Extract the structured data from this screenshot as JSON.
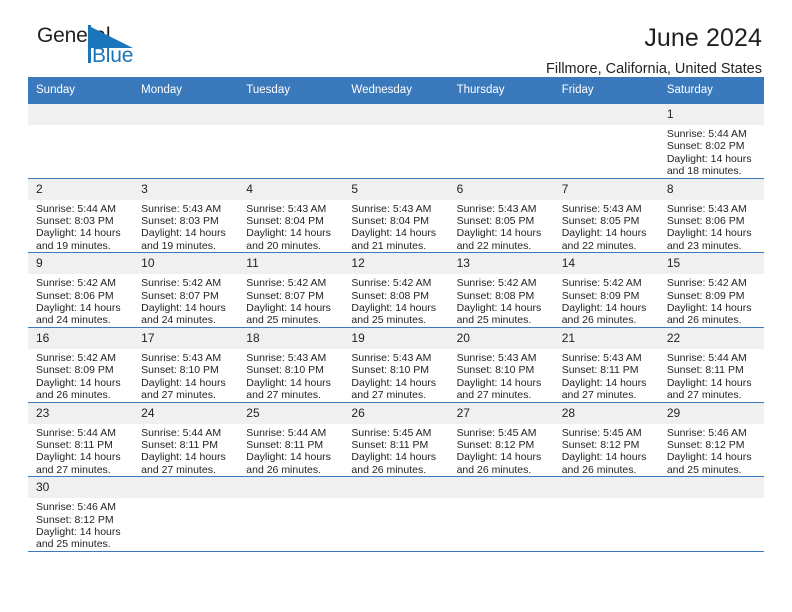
{
  "brand": {
    "word_one": "General",
    "word_two": "Blue",
    "accent_color": "#1b75bb",
    "flag_icon": "brand-flag-icon"
  },
  "header": {
    "title": "June 2024",
    "subtitle": "Fillmore, California, United States"
  },
  "calendar": {
    "header_color": "#3b79bd",
    "weekday_headers": [
      "Sunday",
      "Monday",
      "Tuesday",
      "Wednesday",
      "Thursday",
      "Friday",
      "Saturday"
    ],
    "weeks": [
      [
        {
          "day": "",
          "empty": true
        },
        {
          "day": "",
          "empty": true
        },
        {
          "day": "",
          "empty": true
        },
        {
          "day": "",
          "empty": true
        },
        {
          "day": "",
          "empty": true
        },
        {
          "day": "",
          "empty": true
        },
        {
          "day": "1",
          "sunrise": "Sunrise: 5:44 AM",
          "sunset": "Sunset: 8:02 PM",
          "daylight_line1": "Daylight: 14 hours",
          "daylight_line2": "and 18 minutes."
        }
      ],
      [
        {
          "day": "2",
          "sunrise": "Sunrise: 5:44 AM",
          "sunset": "Sunset: 8:03 PM",
          "daylight_line1": "Daylight: 14 hours",
          "daylight_line2": "and 19 minutes."
        },
        {
          "day": "3",
          "sunrise": "Sunrise: 5:43 AM",
          "sunset": "Sunset: 8:03 PM",
          "daylight_line1": "Daylight: 14 hours",
          "daylight_line2": "and 19 minutes."
        },
        {
          "day": "4",
          "sunrise": "Sunrise: 5:43 AM",
          "sunset": "Sunset: 8:04 PM",
          "daylight_line1": "Daylight: 14 hours",
          "daylight_line2": "and 20 minutes."
        },
        {
          "day": "5",
          "sunrise": "Sunrise: 5:43 AM",
          "sunset": "Sunset: 8:04 PM",
          "daylight_line1": "Daylight: 14 hours",
          "daylight_line2": "and 21 minutes."
        },
        {
          "day": "6",
          "sunrise": "Sunrise: 5:43 AM",
          "sunset": "Sunset: 8:05 PM",
          "daylight_line1": "Daylight: 14 hours",
          "daylight_line2": "and 22 minutes."
        },
        {
          "day": "7",
          "sunrise": "Sunrise: 5:43 AM",
          "sunset": "Sunset: 8:05 PM",
          "daylight_line1": "Daylight: 14 hours",
          "daylight_line2": "and 22 minutes."
        },
        {
          "day": "8",
          "sunrise": "Sunrise: 5:43 AM",
          "sunset": "Sunset: 8:06 PM",
          "daylight_line1": "Daylight: 14 hours",
          "daylight_line2": "and 23 minutes."
        }
      ],
      [
        {
          "day": "9",
          "sunrise": "Sunrise: 5:42 AM",
          "sunset": "Sunset: 8:06 PM",
          "daylight_line1": "Daylight: 14 hours",
          "daylight_line2": "and 24 minutes."
        },
        {
          "day": "10",
          "sunrise": "Sunrise: 5:42 AM",
          "sunset": "Sunset: 8:07 PM",
          "daylight_line1": "Daylight: 14 hours",
          "daylight_line2": "and 24 minutes."
        },
        {
          "day": "11",
          "sunrise": "Sunrise: 5:42 AM",
          "sunset": "Sunset: 8:07 PM",
          "daylight_line1": "Daylight: 14 hours",
          "daylight_line2": "and 25 minutes."
        },
        {
          "day": "12",
          "sunrise": "Sunrise: 5:42 AM",
          "sunset": "Sunset: 8:08 PM",
          "daylight_line1": "Daylight: 14 hours",
          "daylight_line2": "and 25 minutes."
        },
        {
          "day": "13",
          "sunrise": "Sunrise: 5:42 AM",
          "sunset": "Sunset: 8:08 PM",
          "daylight_line1": "Daylight: 14 hours",
          "daylight_line2": "and 25 minutes."
        },
        {
          "day": "14",
          "sunrise": "Sunrise: 5:42 AM",
          "sunset": "Sunset: 8:09 PM",
          "daylight_line1": "Daylight: 14 hours",
          "daylight_line2": "and 26 minutes."
        },
        {
          "day": "15",
          "sunrise": "Sunrise: 5:42 AM",
          "sunset": "Sunset: 8:09 PM",
          "daylight_line1": "Daylight: 14 hours",
          "daylight_line2": "and 26 minutes."
        }
      ],
      [
        {
          "day": "16",
          "sunrise": "Sunrise: 5:42 AM",
          "sunset": "Sunset: 8:09 PM",
          "daylight_line1": "Daylight: 14 hours",
          "daylight_line2": "and 26 minutes."
        },
        {
          "day": "17",
          "sunrise": "Sunrise: 5:43 AM",
          "sunset": "Sunset: 8:10 PM",
          "daylight_line1": "Daylight: 14 hours",
          "daylight_line2": "and 27 minutes."
        },
        {
          "day": "18",
          "sunrise": "Sunrise: 5:43 AM",
          "sunset": "Sunset: 8:10 PM",
          "daylight_line1": "Daylight: 14 hours",
          "daylight_line2": "and 27 minutes."
        },
        {
          "day": "19",
          "sunrise": "Sunrise: 5:43 AM",
          "sunset": "Sunset: 8:10 PM",
          "daylight_line1": "Daylight: 14 hours",
          "daylight_line2": "and 27 minutes."
        },
        {
          "day": "20",
          "sunrise": "Sunrise: 5:43 AM",
          "sunset": "Sunset: 8:10 PM",
          "daylight_line1": "Daylight: 14 hours",
          "daylight_line2": "and 27 minutes."
        },
        {
          "day": "21",
          "sunrise": "Sunrise: 5:43 AM",
          "sunset": "Sunset: 8:11 PM",
          "daylight_line1": "Daylight: 14 hours",
          "daylight_line2": "and 27 minutes."
        },
        {
          "day": "22",
          "sunrise": "Sunrise: 5:44 AM",
          "sunset": "Sunset: 8:11 PM",
          "daylight_line1": "Daylight: 14 hours",
          "daylight_line2": "and 27 minutes."
        }
      ],
      [
        {
          "day": "23",
          "sunrise": "Sunrise: 5:44 AM",
          "sunset": "Sunset: 8:11 PM",
          "daylight_line1": "Daylight: 14 hours",
          "daylight_line2": "and 27 minutes."
        },
        {
          "day": "24",
          "sunrise": "Sunrise: 5:44 AM",
          "sunset": "Sunset: 8:11 PM",
          "daylight_line1": "Daylight: 14 hours",
          "daylight_line2": "and 27 minutes."
        },
        {
          "day": "25",
          "sunrise": "Sunrise: 5:44 AM",
          "sunset": "Sunset: 8:11 PM",
          "daylight_line1": "Daylight: 14 hours",
          "daylight_line2": "and 26 minutes."
        },
        {
          "day": "26",
          "sunrise": "Sunrise: 5:45 AM",
          "sunset": "Sunset: 8:11 PM",
          "daylight_line1": "Daylight: 14 hours",
          "daylight_line2": "and 26 minutes."
        },
        {
          "day": "27",
          "sunrise": "Sunrise: 5:45 AM",
          "sunset": "Sunset: 8:12 PM",
          "daylight_line1": "Daylight: 14 hours",
          "daylight_line2": "and 26 minutes."
        },
        {
          "day": "28",
          "sunrise": "Sunrise: 5:45 AM",
          "sunset": "Sunset: 8:12 PM",
          "daylight_line1": "Daylight: 14 hours",
          "daylight_line2": "and 26 minutes."
        },
        {
          "day": "29",
          "sunrise": "Sunrise: 5:46 AM",
          "sunset": "Sunset: 8:12 PM",
          "daylight_line1": "Daylight: 14 hours",
          "daylight_line2": "and 25 minutes."
        }
      ],
      [
        {
          "day": "30",
          "sunrise": "Sunrise: 5:46 AM",
          "sunset": "Sunset: 8:12 PM",
          "daylight_line1": "Daylight: 14 hours",
          "daylight_line2": "and 25 minutes."
        },
        {
          "day": "",
          "empty": true
        },
        {
          "day": "",
          "empty": true
        },
        {
          "day": "",
          "empty": true
        },
        {
          "day": "",
          "empty": true
        },
        {
          "day": "",
          "empty": true
        },
        {
          "day": "",
          "empty": true
        }
      ]
    ]
  }
}
